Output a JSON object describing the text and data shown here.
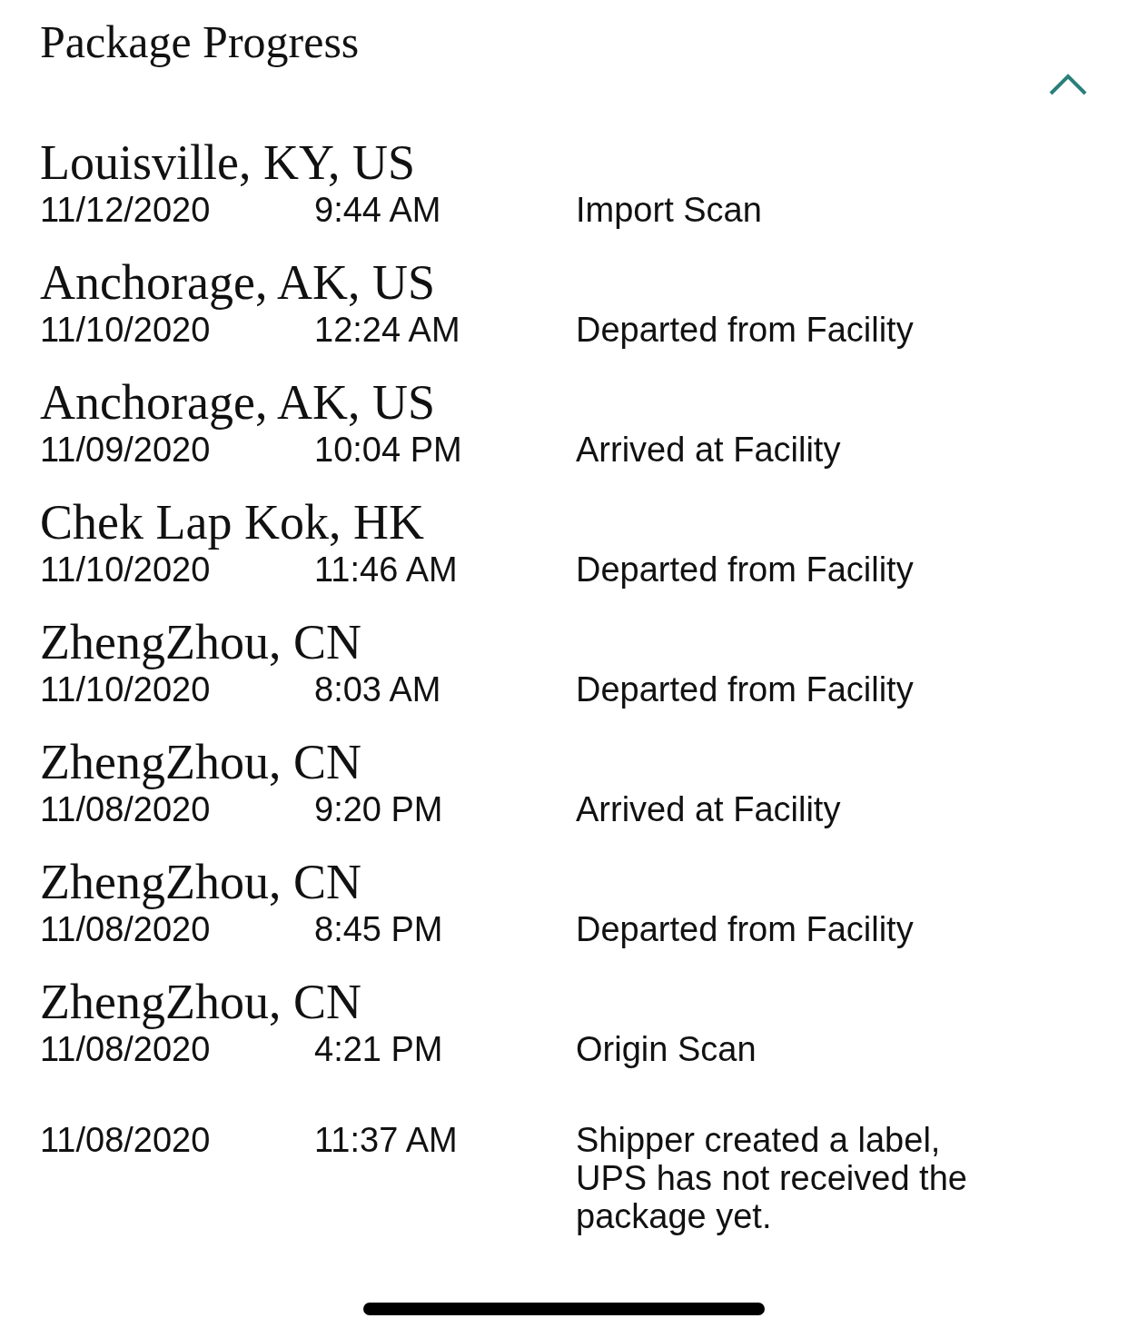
{
  "title": "Package Progress",
  "expanded": true,
  "events": [
    {
      "location": "Louisville, KY, US",
      "date": "11/12/2020",
      "time": "9:44 AM",
      "description": "Import Scan"
    },
    {
      "location": "Anchorage, AK, US",
      "date": "11/10/2020",
      "time": "12:24 AM",
      "description": "Departed from Facility"
    },
    {
      "location": "Anchorage, AK, US",
      "date": "11/09/2020",
      "time": "10:04 PM",
      "description": "Arrived at Facility"
    },
    {
      "location": "Chek Lap Kok, HK",
      "date": "11/10/2020",
      "time": "11:46 AM",
      "description": "Departed from Facility"
    },
    {
      "location": "ZhengZhou, CN",
      "date": "11/10/2020",
      "time": "8:03 AM",
      "description": "Departed from Facility"
    },
    {
      "location": "ZhengZhou, CN",
      "date": "11/08/2020",
      "time": "9:20 PM",
      "description": "Arrived at Facility"
    },
    {
      "location": "ZhengZhou, CN",
      "date": "11/08/2020",
      "time": "8:45 PM",
      "description": "Departed from Facility"
    },
    {
      "location": "ZhengZhou, CN",
      "date": "11/08/2020",
      "time": "4:21 PM",
      "description": "Origin Scan"
    },
    {
      "date": "11/08/2020",
      "time": "11:37 AM",
      "description": "Shipper created a label, UPS has not received the package yet."
    }
  ]
}
